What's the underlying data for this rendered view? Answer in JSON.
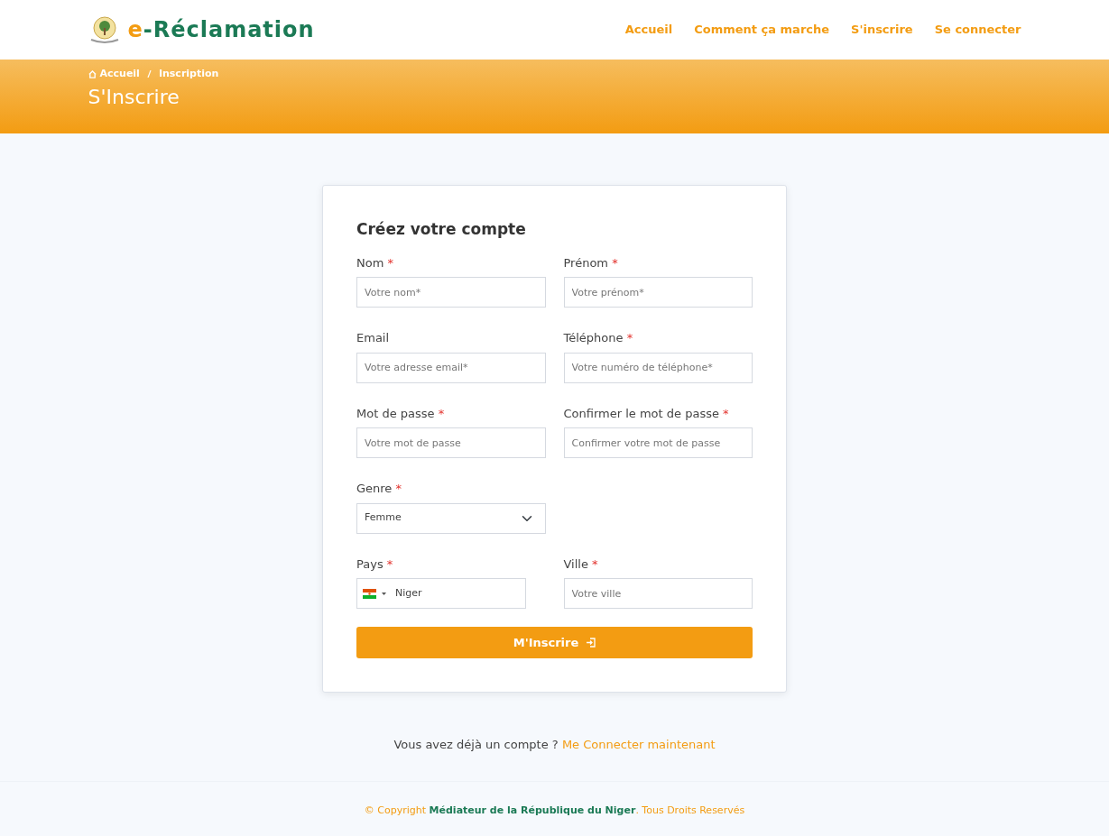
{
  "logo": {
    "prefix": "e",
    "name": "-Réclamation"
  },
  "nav": [
    "Accueil",
    "Comment ça marche",
    "S'inscrire",
    "Se connecter"
  ],
  "breadcrumb": [
    "Accueil",
    "Inscription"
  ],
  "page_title": "S'Inscrire",
  "form": {
    "title": "Créez votre compte",
    "rows": [
      [
        {
          "kind": "input",
          "label": "Nom",
          "required_mark": "*",
          "placeholder": "Votre nom*"
        },
        {
          "kind": "input",
          "label": "Prénom",
          "required_mark": "*",
          "placeholder": "Votre prénom*"
        }
      ],
      [
        {
          "kind": "input",
          "label": "Email",
          "placeholder": "Votre adresse email*"
        },
        {
          "kind": "input",
          "label": "Téléphone",
          "required_mark": "*",
          "placeholder": "Votre numéro de téléphone*"
        }
      ],
      [
        {
          "kind": "input",
          "label": "Mot de passe",
          "required_mark": "*",
          "placeholder": "Votre mot de passe"
        },
        {
          "kind": "input",
          "label": "Confirmer le mot de passe",
          "required_mark": "*",
          "placeholder": "Confirmer votre mot de passe"
        }
      ],
      [
        {
          "kind": "select",
          "label": "Genre",
          "required_mark": "*",
          "value": "Femme"
        }
      ],
      [
        {
          "kind": "country",
          "label": "Pays",
          "required_mark": "*",
          "value": "Niger"
        },
        {
          "kind": "input",
          "label": "Ville",
          "required_mark": "*",
          "placeholder": "Votre ville"
        }
      ]
    ],
    "submit": "M'Inscrire"
  },
  "login_prompt": {
    "text": "Vous avez déjà un compte ?",
    "link": "Me Connecter maintenant"
  },
  "footer": "© Copyright **Médiateur de la République du Niger**. Tous Droits Reservés"
}
